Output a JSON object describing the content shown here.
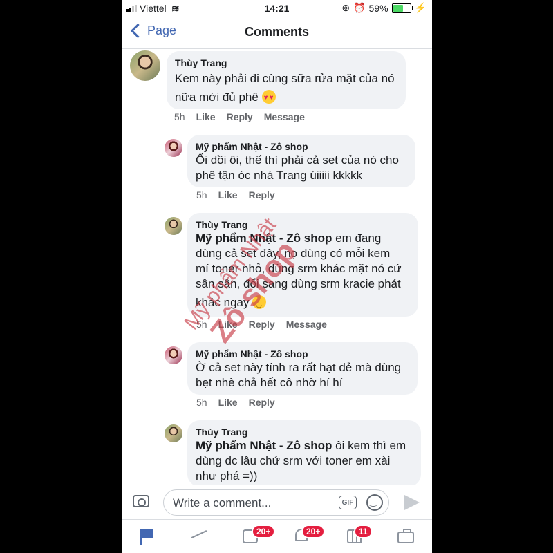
{
  "status_bar": {
    "carrier": "Viettel",
    "time": "14:21",
    "battery": "59%",
    "battery_level": 0.59
  },
  "nav": {
    "back_label": "Page",
    "title": "Comments"
  },
  "comments": [
    {
      "author": "Thùy Trang",
      "lines": [
        "Kem này phải đi cùng sữa rửa mặt của nó",
        "nữa mới đủ phê"
      ],
      "emoji": "heart-eyes-emoji",
      "time": "5h",
      "actions": [
        "Like",
        "Reply",
        "Message"
      ]
    },
    {
      "author": "Mỹ phẩm Nhật - Zô shop",
      "lines": [
        "Ối dồi ôi, thế thì phải cả set của nó cho",
        "phê tận óc nhá Trang úiiiii kkkkk"
      ],
      "time": "5h",
      "actions": [
        "Like",
        "Reply"
      ]
    },
    {
      "author": "Thùy Trang",
      "mention": "Mỹ phẩm Nhật - Zô shop",
      "lines": [
        " em đang",
        "dùng cả set đây, nọ dùng có mỗi kem",
        "mí toner nhỏ, dùng srm khác mặt nó cứ",
        "sần sần, đổi sang dùng srm kracie phát",
        "khác ngay"
      ],
      "emoji": "hugging-emoji",
      "time": "5h",
      "actions": [
        "Like",
        "Reply",
        "Message"
      ]
    },
    {
      "author": "Mỹ phẩm Nhật - Zô shop",
      "lines": [
        "Ờ cả set này tính ra rất hạt dẻ mà dùng",
        "bẹt nhè chả hết cô nhờ hí hí"
      ],
      "time": "5h",
      "actions": [
        "Like",
        "Reply"
      ]
    },
    {
      "author": "Thùy Trang",
      "mention": "Mỹ phẩm Nhật - Zô shop",
      "lines": [
        " ôi kem thì em",
        "dùng dc lâu chứ srm với toner em xài",
        "như phá =))"
      ]
    }
  ],
  "watermark": {
    "line1": "Mỹ phẩm Nhật",
    "line2": "Zô shop"
  },
  "composer": {
    "placeholder": "Write a comment...",
    "gif_label": "GIF"
  },
  "tabbar": {
    "badges": {
      "inbox": "20+",
      "notifications": "20+",
      "events": "11"
    }
  },
  "colors": {
    "accent": "#4267b2",
    "badge": "#e41e3f",
    "bubble": "#f0f2f5"
  }
}
